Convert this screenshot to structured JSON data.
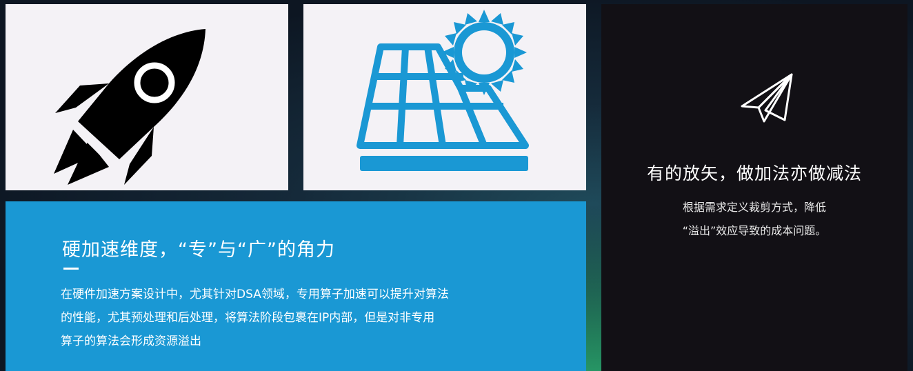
{
  "tiles": {
    "rocket_icon": "rocket-icon",
    "solar_icon": "solar-panel-icon"
  },
  "blue_panel": {
    "title": "硬加速维度，“专”与“广”的角力",
    "body_lines": [
      "在硬件加速方案设计中，尤其针对DSA领域，专用算子加速可以提升对算法",
      "的性能，尤其预处理和后处理，将算法阶段包裹在IP内部，但是对非专用",
      "算子的算法会形成资源溢出"
    ],
    "color": "#1a98d4"
  },
  "dark_panel": {
    "icon": "paper-plane-icon",
    "title": "有的放矢，做加法亦做减法",
    "body_lines": [
      "根据需求定义裁剪方式，降低",
      "“溢出”效应导致的成本问题。"
    ],
    "color": "#121015"
  }
}
